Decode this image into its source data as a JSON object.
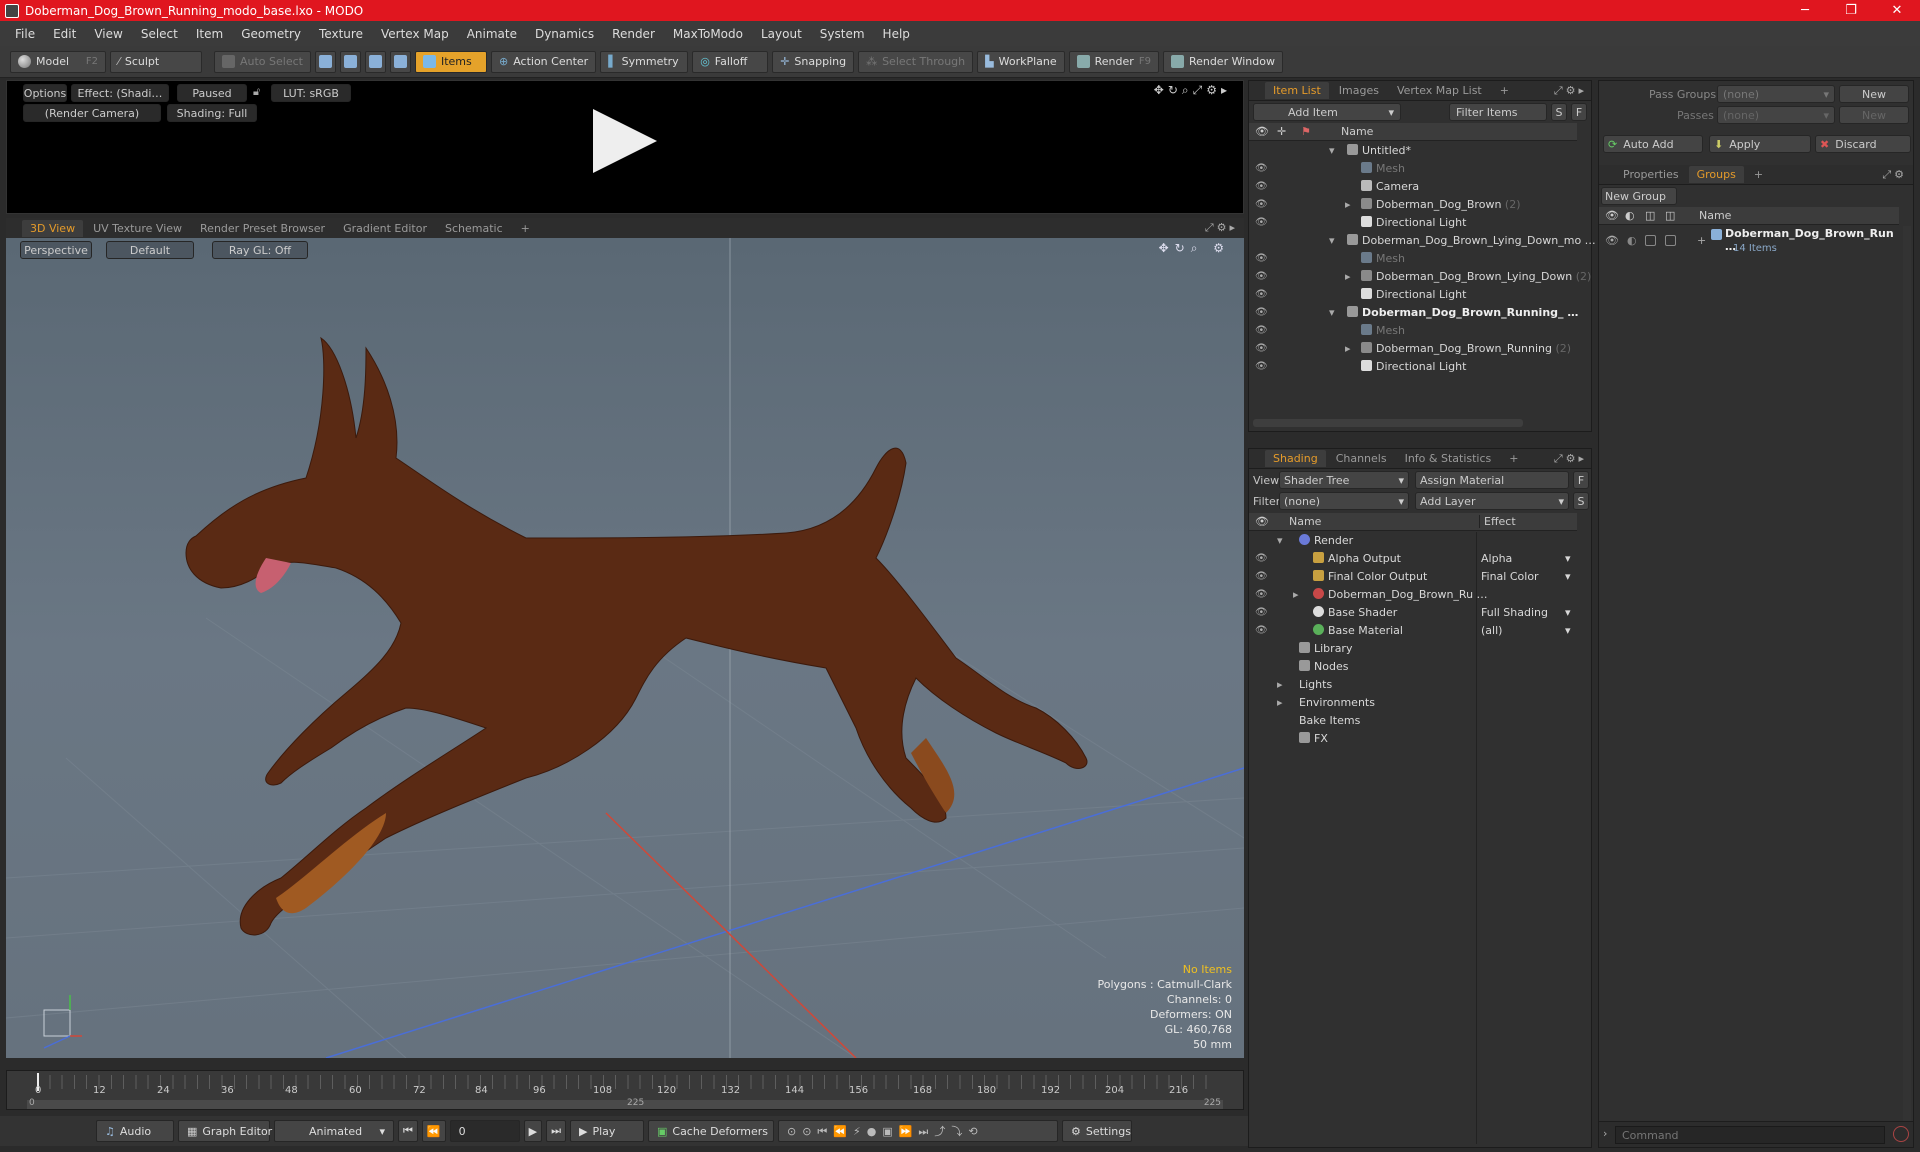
{
  "window": {
    "title": "Doberman_Dog_Brown_Running_modo_base.lxo - MODO",
    "min": "─",
    "max": "❐",
    "close": "✕"
  },
  "menu": [
    "File",
    "Edit",
    "View",
    "Select",
    "Item",
    "Geometry",
    "Texture",
    "Vertex Map",
    "Animate",
    "Dynamics",
    "Render",
    "MaxToModo",
    "Layout",
    "System",
    "Help"
  ],
  "toolbar": {
    "model": "Model",
    "model_key": "F2",
    "sculpt": "Sculpt",
    "auto_select": "Auto Select",
    "items": "Items",
    "action_center": "Action Center",
    "symmetry": "Symmetry",
    "falloff": "Falloff",
    "snapping": "Snapping",
    "select_through": "Select Through",
    "workplane": "WorkPlane",
    "render": "Render",
    "render_key": "F9",
    "render_window": "Render Window"
  },
  "preview": {
    "options": "Options",
    "effect": "Effect: (Shadi…",
    "paused": "Paused",
    "lut": "LUT: sRGB",
    "camera": "(Render Camera)",
    "shading": "Shading: Full"
  },
  "viewport_tabs": [
    "3D View",
    "UV Texture View",
    "Render Preset Browser",
    "Gradient Editor",
    "Schematic",
    "+"
  ],
  "viewport": {
    "perspective": "Perspective",
    "default": "Default",
    "raygl": "Ray GL: Off"
  },
  "status": {
    "no_items": "No Items",
    "polygons": "Polygons : Catmull-Clark",
    "channels": "Channels: 0",
    "deformers": "Deformers: ON",
    "gl": "GL: 460,768",
    "focal": "50 mm"
  },
  "timeline": {
    "ticks": [
      "0",
      "12",
      "24",
      "36",
      "48",
      "60",
      "72",
      "84",
      "96",
      "108",
      "120",
      "132",
      "144",
      "156",
      "168",
      "180",
      "192",
      "204",
      "216"
    ],
    "start": "0",
    "mid": "225",
    "end": "225"
  },
  "bottom": {
    "audio": "Audio",
    "graph_editor": "Graph Editor",
    "animated": "Animated",
    "frame": "0",
    "play": "Play",
    "cache": "Cache Deformers",
    "settings": "Settings"
  },
  "item_list": {
    "tabs": [
      "Item List",
      "Images",
      "Vertex Map List",
      "+"
    ],
    "add_item": "Add Item",
    "filter_items": "Filter Items",
    "s": "S",
    "f": "F",
    "col_name": "Name",
    "rows": [
      {
        "label": "Untitled*",
        "cnt": ""
      },
      {
        "label": "Mesh",
        "cnt": ""
      },
      {
        "label": "Camera",
        "cnt": ""
      },
      {
        "label": "Doberman_Dog_Brown",
        "cnt": "(2)"
      },
      {
        "label": "Directional Light",
        "cnt": ""
      },
      {
        "label": "Doberman_Dog_Brown_Lying_Down_mo …",
        "cnt": ""
      },
      {
        "label": "Mesh",
        "cnt": ""
      },
      {
        "label": "Doberman_Dog_Brown_Lying_Down",
        "cnt": "(2)"
      },
      {
        "label": "Directional Light",
        "cnt": ""
      },
      {
        "label": "Doberman_Dog_Brown_Running_ …",
        "cnt": ""
      },
      {
        "label": "Mesh",
        "cnt": ""
      },
      {
        "label": "Doberman_Dog_Brown_Running",
        "cnt": "(2)"
      },
      {
        "label": "Directional Light",
        "cnt": ""
      }
    ]
  },
  "shading": {
    "tabs": [
      "Shading",
      "Channels",
      "Info & Statistics",
      "+"
    ],
    "view_label": "View",
    "view_value": "Shader Tree",
    "assign": "Assign Material",
    "f": "F",
    "filter_label": "Filter",
    "filter_value": "(none)",
    "add_layer": "Add Layer",
    "s": "S",
    "col_name": "Name",
    "col_effect": "Effect",
    "rows": [
      {
        "label": "Render",
        "effect": ""
      },
      {
        "label": "Alpha Output",
        "effect": "Alpha"
      },
      {
        "label": "Final Color Output",
        "effect": "Final Color"
      },
      {
        "label": "Doberman_Dog_Brown_Ru …",
        "effect": ""
      },
      {
        "label": "Base Shader",
        "effect": "Full Shading"
      },
      {
        "label": "Base Material",
        "effect": "(all)"
      },
      {
        "label": "Library",
        "effect": ""
      },
      {
        "label": "Nodes",
        "effect": ""
      },
      {
        "label": "Lights",
        "effect": ""
      },
      {
        "label": "Environments",
        "effect": ""
      },
      {
        "label": "Bake Items",
        "effect": ""
      },
      {
        "label": "FX",
        "effect": ""
      }
    ]
  },
  "right_panel": {
    "pass_groups": "Pass Groups",
    "passes": "Passes",
    "none": "(none)",
    "new": "New",
    "auto_add": "Auto Add",
    "apply": "Apply",
    "discard": "Discard",
    "tabs": [
      "Properties",
      "Groups",
      "+"
    ],
    "new_group": "New Group",
    "col_name": "Name",
    "group_name": "Doberman_Dog_Brown_Run …",
    "group_count": "14 Items",
    "command": "Command"
  }
}
